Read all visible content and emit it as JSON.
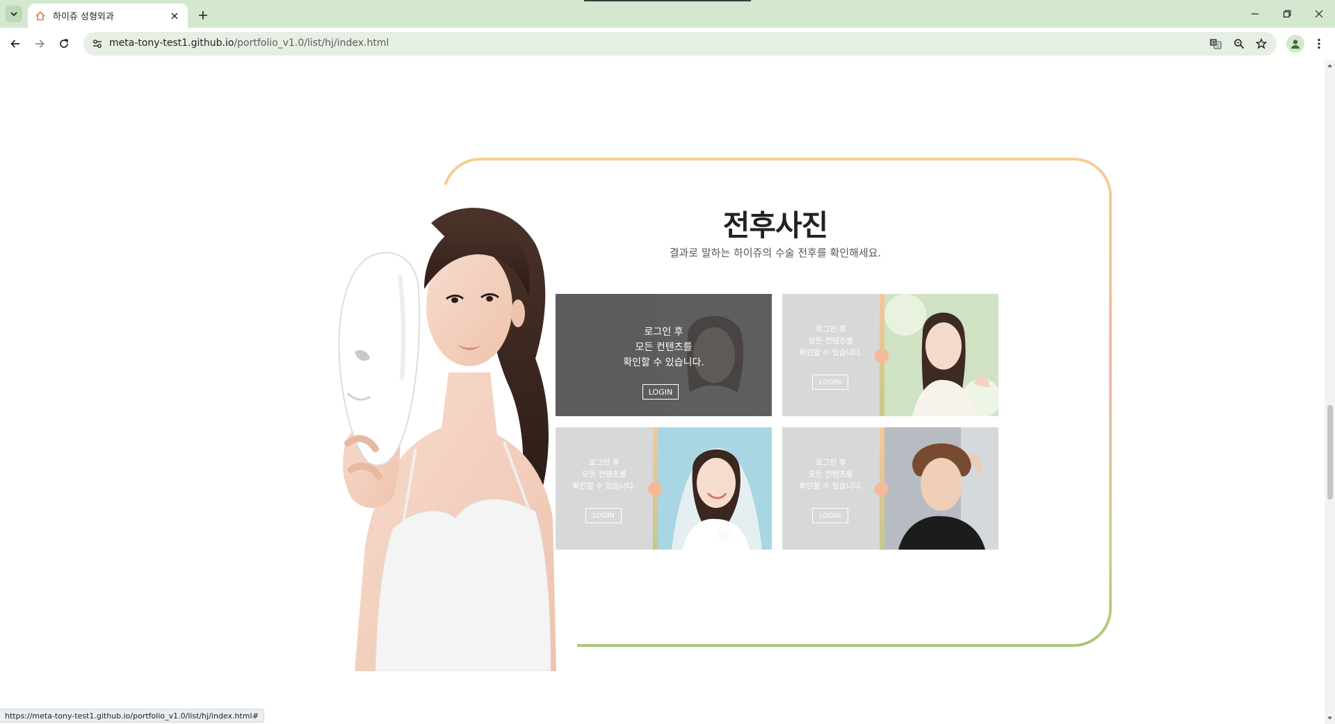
{
  "browser": {
    "tab_title": "하이쥬 성형외과",
    "url_host": "meta-tony-test1.github.io",
    "url_path": "/portfolio_v1.0/list/hj/index.html",
    "status_url": "https://meta-tony-test1.github.io/portfolio_v1.0/list/hj/index.html#",
    "icons": [
      "tab-search-icon",
      "home-favicon-icon",
      "close-icon",
      "plus-icon",
      "minimize-icon",
      "restore-icon",
      "back-icon",
      "forward-icon",
      "reload-icon",
      "site-info-icon",
      "translate-icon",
      "zoom-icon",
      "star-icon",
      "profile-icon",
      "more-menu-icon"
    ]
  },
  "section": {
    "title": "전후사진",
    "subtitle": "결과로 말하는 하이쥬의 수술 전후를 확인해세요."
  },
  "gallery": {
    "cards": [
      {
        "text": "로그인 후\n모든 컨텐츠를\n확인할 수 있습니다.",
        "login_label": "LOGIN",
        "state": "hover"
      },
      {
        "text": "로그인 후\n모든 컨텐츠를\n확인할 수 있습니다.",
        "login_label": "LOGIN",
        "state": "normal"
      },
      {
        "text": "로그인 후\n모든 컨텐츠를\n확인할 수 있습니다.",
        "login_label": "LOGIN",
        "state": "normal"
      },
      {
        "text": "로그인 후\n모든 컨텐츠를\n확인할 수 있습니다.",
        "login_label": "LOGIN",
        "state": "normal"
      }
    ]
  },
  "colors": {
    "chrome_bg": "#d3e8cf",
    "frame_gradient_top": "#f6cf94",
    "frame_gradient_bottom": "#a8c877",
    "accent_dot": "#f5b996"
  }
}
